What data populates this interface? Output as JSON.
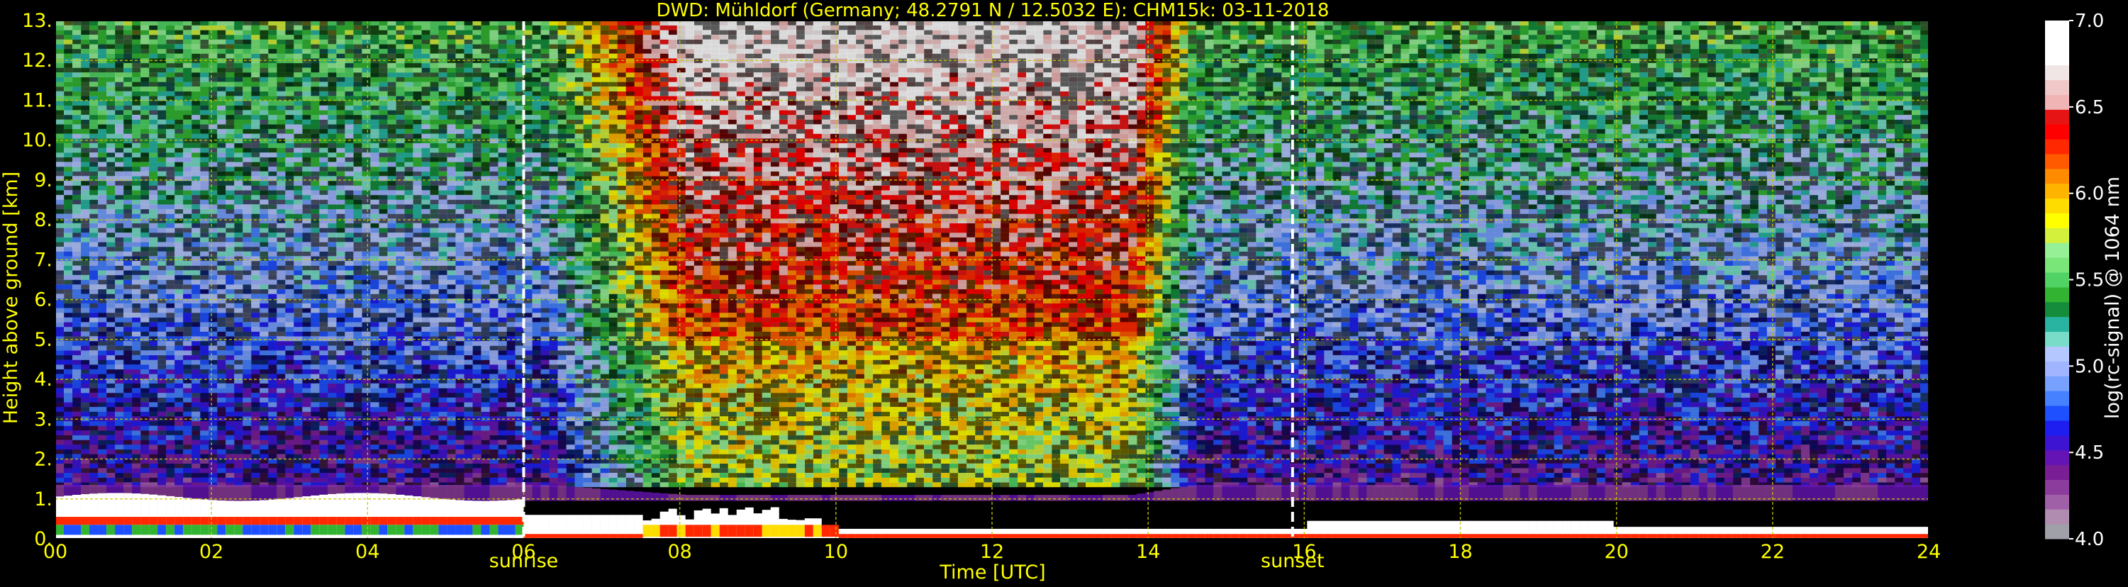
{
  "chart_data": {
    "type": "heatmap",
    "title": "DWD: Mühldorf (Germany; 48.2791 N / 12.5032 E):    CHM15k: 03-11-2018",
    "xlabel": "Time [UTC]",
    "ylabel": "Height above ground [km]",
    "xlim": [
      0,
      24
    ],
    "ylim": [
      0,
      13
    ],
    "x_ticks": [
      "00",
      "02",
      "04",
      "06",
      "08",
      "10",
      "12",
      "14",
      "16",
      "18",
      "20",
      "22",
      "24"
    ],
    "y_ticks": [
      "0.",
      "1.",
      "2.",
      "3.",
      "4.",
      "5.",
      "6.",
      "7.",
      "8.",
      "9.",
      "10.",
      "11.",
      "12.",
      "13."
    ],
    "grid": true,
    "markers": [
      {
        "label": "sunrise",
        "time": 6.0
      },
      {
        "label": "sunset",
        "time": 15.85
      }
    ],
    "colorbar": {
      "label": "log(rc-signal) @ 1064 nm",
      "range": [
        4.0,
        7.0
      ],
      "ticks": [
        "4.0",
        "4.5",
        "5.0",
        "5.5",
        "6.0",
        "6.5",
        "7.0"
      ],
      "colors": [
        "#a0a0a8",
        "#b08cb0",
        "#a060a8",
        "#8c3c9c",
        "#7a1e96",
        "#6414b4",
        "#3c14d2",
        "#1e1ef0",
        "#1e50ff",
        "#4682ff",
        "#78a0ff",
        "#a0b4ff",
        "#b4c8ff",
        "#78dcc8",
        "#28b4a0",
        "#148c3c",
        "#32b432",
        "#50d264",
        "#78e678",
        "#96f096",
        "#d2f03c",
        "#ffff00",
        "#ffdc00",
        "#ffb400",
        "#ff8c00",
        "#ff5a00",
        "#ff2800",
        "#ff0000",
        "#e61414",
        "#f0b4b4",
        "#f0c8c8",
        "#f0e6e6",
        "#ffffff",
        "#ffffff",
        "#ffffff"
      ]
    },
    "colors": {
      "text": "#ffff00",
      "grid": "#c8c800",
      "colorbar_text": "#ffffff",
      "marker_line": "#ffffff",
      "background": "#000000"
    }
  }
}
